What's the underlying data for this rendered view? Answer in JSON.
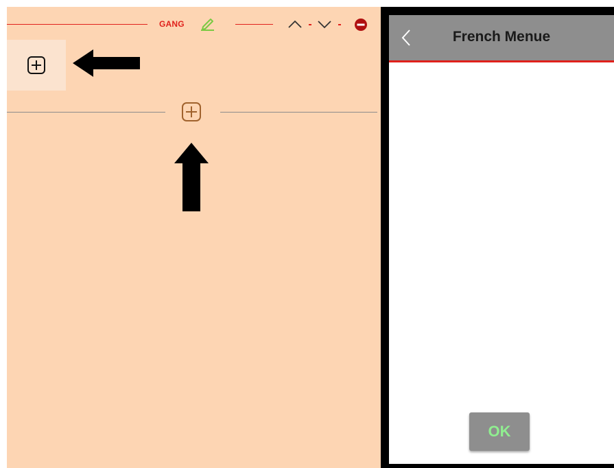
{
  "editor": {
    "gang_label": "GANG",
    "icons": {
      "edit": "pencil-icon",
      "move_up": "chevron-up-icon",
      "move_down": "chevron-down-icon",
      "remove": "remove-circle-icon",
      "add_top": "add-square-icon",
      "add_center": "add-square-icon",
      "arrow_left": "arrow-left-icon",
      "arrow_up": "arrow-up-icon"
    },
    "colors": {
      "background": "#fdd5b3",
      "add_box_background": "#fbe3cf",
      "accent_red": "#e0201b",
      "edit_green": "#7ac943",
      "remove_dark_red": "#b01010",
      "add_center_brown": "#a0622d"
    }
  },
  "menu_panel": {
    "title": "French Menue",
    "ok_label": "OK",
    "icons": {
      "back": "chevron-left-icon"
    },
    "colors": {
      "header_background": "#8e8e8e",
      "header_border": "#e0201b",
      "ok_text": "#90ee90",
      "frame": "#000000"
    }
  }
}
